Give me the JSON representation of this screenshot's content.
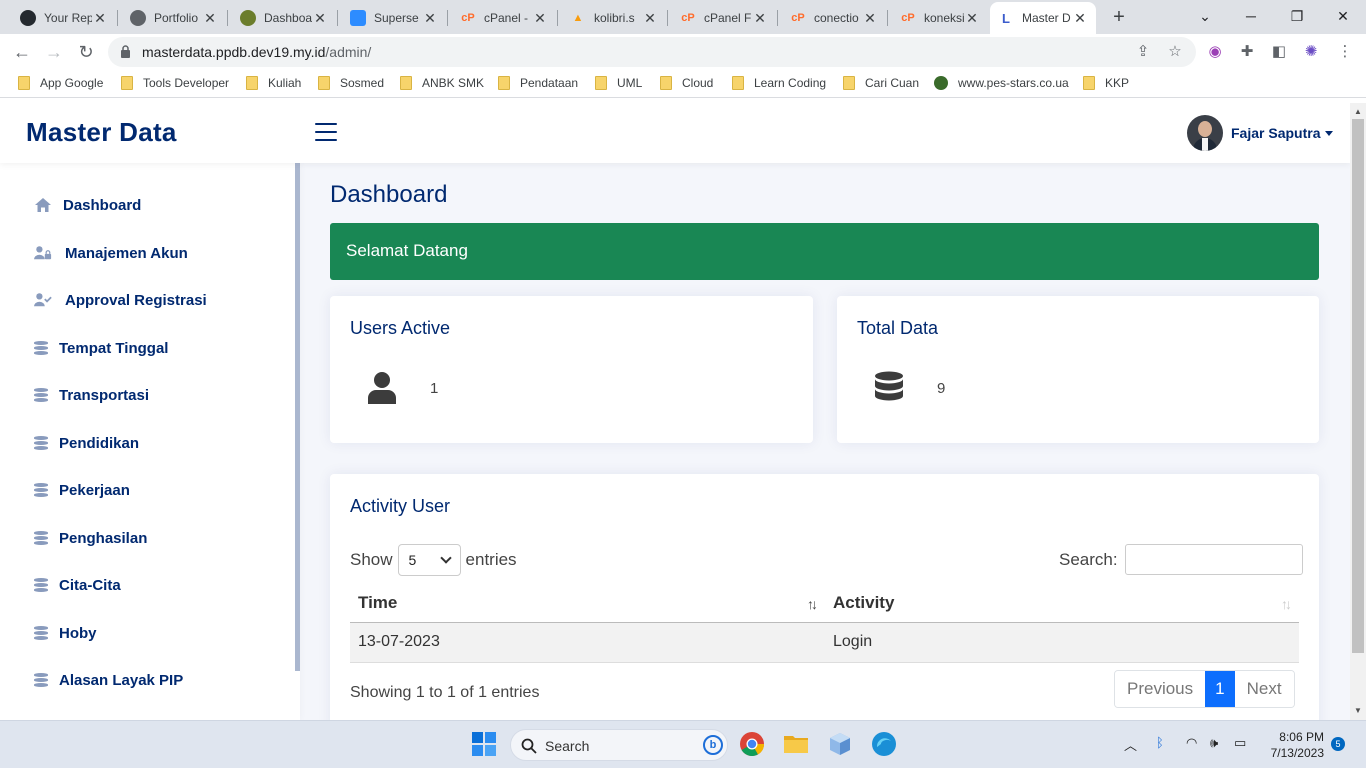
{
  "browser": {
    "tabs": [
      {
        "title": "Your Rep",
        "icon": "github-icon"
      },
      {
        "title": "Portfolio",
        "icon": "globe-icon"
      },
      {
        "title": "Dashboa",
        "icon": "ministry-logo-icon"
      },
      {
        "title": "Superse",
        "icon": "blue-square-icon"
      },
      {
        "title": "cPanel -",
        "icon": "cpanel-icon"
      },
      {
        "title": "kolibri.s",
        "icon": "phpmyadmin-icon"
      },
      {
        "title": "cPanel F",
        "icon": "cpanel-icon"
      },
      {
        "title": "conectio",
        "icon": "cpanel-icon"
      },
      {
        "title": "koneksi",
        "icon": "cpanel-icon"
      },
      {
        "title": "Master D",
        "icon": "laravel-icon"
      }
    ],
    "active_tab": 9,
    "url_host": "masterdata.ppdb.dev19.my.id",
    "url_path": "/admin/",
    "bookmarks": [
      {
        "label": "App Google",
        "type": "folder"
      },
      {
        "label": "Tools Developer",
        "type": "folder"
      },
      {
        "label": "Kuliah",
        "type": "folder"
      },
      {
        "label": "Sosmed",
        "type": "folder"
      },
      {
        "label": "ANBK SMK",
        "type": "folder"
      },
      {
        "label": "Pendataan",
        "type": "folder"
      },
      {
        "label": "UML",
        "type": "folder"
      },
      {
        "label": "Cloud",
        "type": "folder"
      },
      {
        "label": "Learn Coding",
        "type": "folder"
      },
      {
        "label": "Cari Cuan",
        "type": "folder"
      },
      {
        "label": "www.pes-stars.co.ua",
        "type": "site"
      },
      {
        "label": "KKP",
        "type": "folder"
      }
    ]
  },
  "app": {
    "brand": "Master Data",
    "user_name": "Fajar Saputra",
    "sidebar": [
      {
        "label": "Dashboard",
        "icon": "house-icon"
      },
      {
        "label": "Manajemen Akun",
        "icon": "user-lock-icon"
      },
      {
        "label": "Approval Registrasi",
        "icon": "user-check-icon"
      },
      {
        "label": "Tempat Tinggal",
        "icon": "database-icon"
      },
      {
        "label": "Transportasi",
        "icon": "database-icon"
      },
      {
        "label": "Pendidikan",
        "icon": "database-icon"
      },
      {
        "label": "Pekerjaan",
        "icon": "database-icon"
      },
      {
        "label": "Penghasilan",
        "icon": "database-icon"
      },
      {
        "label": "Cita-Cita",
        "icon": "database-icon"
      },
      {
        "label": "Hoby",
        "icon": "database-icon"
      },
      {
        "label": "Alasan Layak PIP",
        "icon": "database-icon"
      }
    ],
    "page_title": "Dashboard",
    "welcome": "Selamat Datang",
    "cards": {
      "users_active": {
        "title": "Users Active",
        "value": "1",
        "icon": "person-icon"
      },
      "total_data": {
        "title": "Total Data",
        "value": "9",
        "icon": "database-icon"
      }
    },
    "activity": {
      "title": "Activity User",
      "show_label": "Show",
      "entries_value": "5",
      "entries_label": "entries",
      "search_label": "Search:",
      "columns": [
        "Time",
        "Activity"
      ],
      "rows": [
        [
          "13-07-2023",
          "Login"
        ]
      ],
      "info": "Showing 1 to 1 of 1 entries",
      "pagination": {
        "prev": "Previous",
        "current": "1",
        "next": "Next"
      }
    }
  },
  "taskbar": {
    "search_label": "Search",
    "time": "8:06 PM",
    "date": "7/13/2023",
    "notification_count": "5"
  }
}
